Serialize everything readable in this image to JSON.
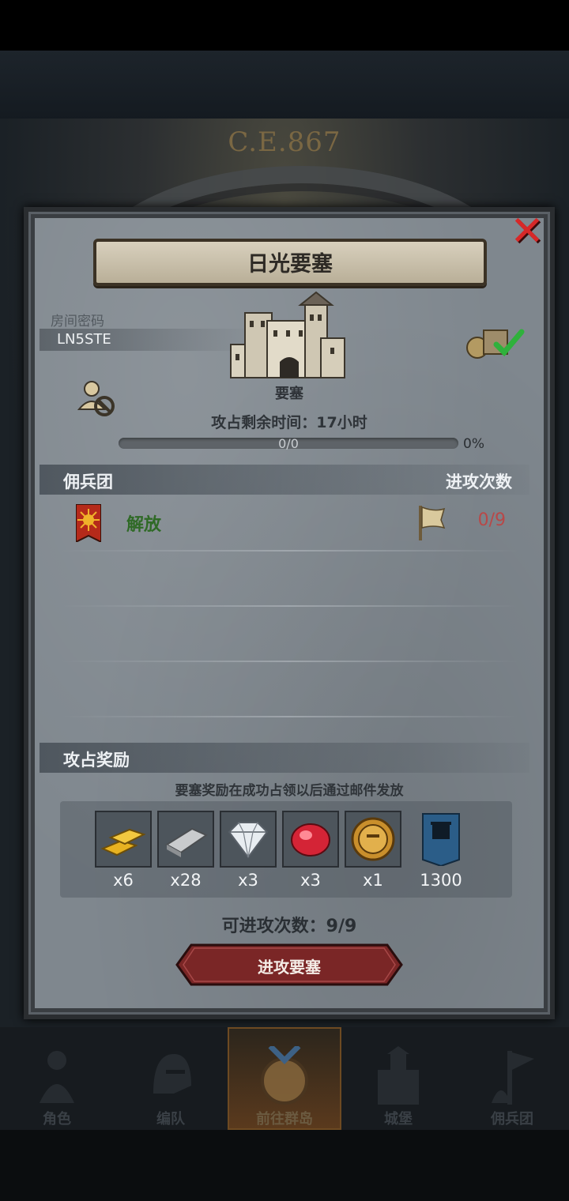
{
  "background": {
    "era_text": "C.E.867"
  },
  "dialog": {
    "title": "日光要塞",
    "room_code_label": "房间密码",
    "room_code": "LN5STE",
    "fortress_label": "要塞",
    "time_remaining": "攻占剩余时间：17小时",
    "progress_count": "0/0",
    "progress_percent": "0%",
    "progress_fraction": 0,
    "mercenary_header": "佣兵团",
    "attack_count_header": "进攻次数",
    "guild": {
      "name": "解放",
      "attacks": "0/9"
    },
    "reward_header": "攻占奖励",
    "reward_note": "要塞奖励在成功占领以后通过邮件发放",
    "rewards": [
      {
        "icon": "gold-bars-icon",
        "qty": "x6"
      },
      {
        "icon": "silver-ingot-icon",
        "qty": "x28"
      },
      {
        "icon": "diamond-icon",
        "qty": "x3"
      },
      {
        "icon": "ruby-icon",
        "qty": "x3"
      },
      {
        "icon": "helmet-coin-icon",
        "qty": "x1"
      },
      {
        "icon": "fortress-banner-icon",
        "qty": "1300"
      }
    ],
    "attacks_left": "可进攻次数：9/9",
    "attack_button": "进攻要塞"
  },
  "nav": [
    {
      "label": "角色",
      "icon": "knight-icon"
    },
    {
      "label": "编队",
      "icon": "helmet-icon"
    },
    {
      "label": "前往群岛",
      "icon": "compass-globe-icon"
    },
    {
      "label": "城堡",
      "icon": "castle-icon"
    },
    {
      "label": "佣兵团",
      "icon": "mercenary-icon"
    }
  ],
  "colors": {
    "guild_name": "#2f6a26",
    "attack_count": "#b84848",
    "close": "#d72828"
  }
}
